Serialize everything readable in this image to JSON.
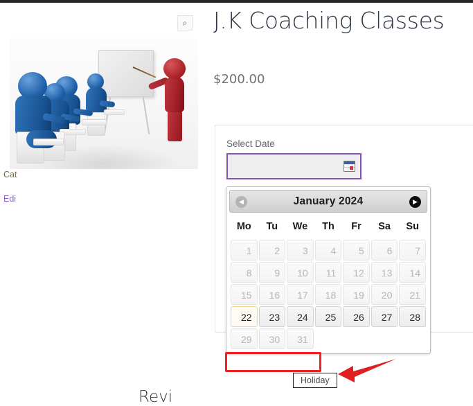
{
  "page": {
    "background": "#ffffff",
    "topbar_color": "#23282d"
  },
  "gallery": {
    "zoom_icon": "magnifier-zoom-icon",
    "zoom_glyph": "⌕",
    "image_alt": "3D illustration of a red teacher figure pointing at a whiteboard in front of blue seated student figures"
  },
  "product": {
    "title": "J.K Coaching Classes",
    "price": "$200.00"
  },
  "form": {
    "select_date_label": "Select Date",
    "date_input_value": "",
    "date_input_placeholder": "",
    "calendar_icon": "calendar-picker-icon",
    "accent_color": "#7f54b3"
  },
  "meta": {
    "category_partial": "Cat",
    "edit_partial": "Edi"
  },
  "reviews": {
    "heading_partial": "Revi"
  },
  "datepicker": {
    "title": "January 2024",
    "prev_label": "◀",
    "next_label": "▶",
    "prev_enabled": false,
    "next_enabled": true,
    "weekdays": [
      "Mo",
      "Tu",
      "We",
      "Th",
      "Fr",
      "Sa",
      "Su"
    ],
    "weeks": [
      [
        {
          "day": "1",
          "state": "disabled"
        },
        {
          "day": "2",
          "state": "disabled"
        },
        {
          "day": "3",
          "state": "disabled"
        },
        {
          "day": "4",
          "state": "disabled"
        },
        {
          "day": "5",
          "state": "disabled"
        },
        {
          "day": "6",
          "state": "disabled"
        },
        {
          "day": "7",
          "state": "disabled"
        }
      ],
      [
        {
          "day": "8",
          "state": "disabled"
        },
        {
          "day": "9",
          "state": "disabled"
        },
        {
          "day": "10",
          "state": "disabled"
        },
        {
          "day": "11",
          "state": "disabled"
        },
        {
          "day": "12",
          "state": "disabled"
        },
        {
          "day": "13",
          "state": "disabled"
        },
        {
          "day": "14",
          "state": "disabled"
        }
      ],
      [
        {
          "day": "15",
          "state": "disabled"
        },
        {
          "day": "16",
          "state": "disabled"
        },
        {
          "day": "17",
          "state": "disabled"
        },
        {
          "day": "18",
          "state": "disabled"
        },
        {
          "day": "19",
          "state": "disabled"
        },
        {
          "day": "20",
          "state": "disabled"
        },
        {
          "day": "21",
          "state": "disabled"
        }
      ],
      [
        {
          "day": "22",
          "state": "today"
        },
        {
          "day": "23",
          "state": "enabled"
        },
        {
          "day": "24",
          "state": "enabled"
        },
        {
          "day": "25",
          "state": "enabled"
        },
        {
          "day": "26",
          "state": "enabled"
        },
        {
          "day": "27",
          "state": "enabled"
        },
        {
          "day": "28",
          "state": "enabled"
        }
      ],
      [
        {
          "day": "29",
          "state": "disabled"
        },
        {
          "day": "30",
          "state": "disabled"
        },
        {
          "day": "31",
          "state": "disabled"
        },
        {
          "day": "",
          "state": "empty"
        },
        {
          "day": "",
          "state": "empty"
        },
        {
          "day": "",
          "state": "empty"
        },
        {
          "day": "",
          "state": "empty"
        }
      ]
    ]
  },
  "annotations": {
    "highlight_color": "#ee2020",
    "tooltip_text": "Holiday",
    "arrow_color": "#e02020"
  }
}
